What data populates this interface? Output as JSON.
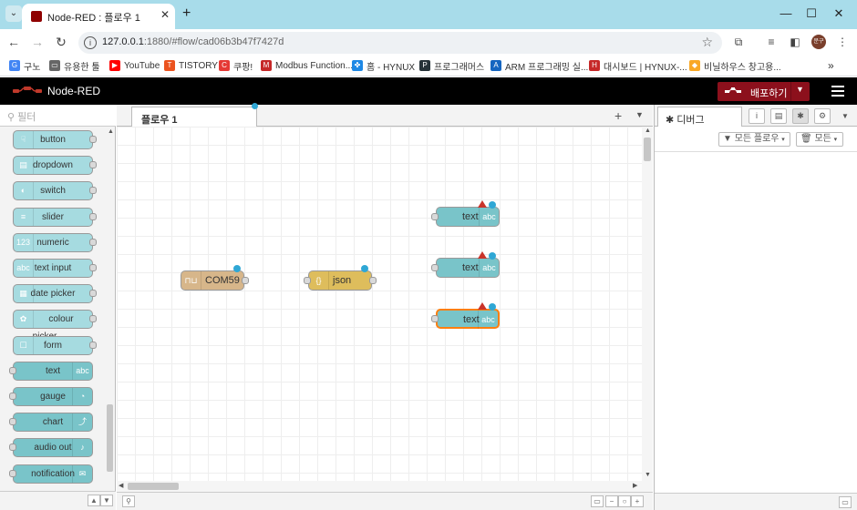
{
  "browser": {
    "tab_title": "Node-RED : 플로우 1",
    "url_host": "127.0.0.1",
    "url_rest": ":1880/#flow/cad06b3b47f7427d",
    "profile_initials": "문구"
  },
  "bookmarks": [
    {
      "label": "구노",
      "color": "#4285f4",
      "glyph": "G"
    },
    {
      "label": "유용한 툴",
      "color": "#666666",
      "glyph": "▭"
    },
    {
      "label": "YouTube",
      "color": "#ff0000",
      "glyph": "▶"
    },
    {
      "label": "TISTORY",
      "color": "#eb531f",
      "glyph": "T"
    },
    {
      "label": "쿠팡!",
      "color": "#e53935",
      "glyph": "C"
    },
    {
      "label": "Modbus Function...",
      "color": "#c62828",
      "glyph": "M"
    },
    {
      "label": "홈 - HYNUX",
      "color": "#1e88e5",
      "glyph": "✤"
    },
    {
      "label": "프로그래머스",
      "color": "#263238",
      "glyph": "P"
    },
    {
      "label": "ARM 프로그래밍 실...",
      "color": "#1565c0",
      "glyph": "A"
    },
    {
      "label": "대시보드 | HYNUX-...",
      "color": "#c62828",
      "glyph": "H"
    },
    {
      "label": "비닐하우스 창고용...",
      "color": "#f9a825",
      "glyph": "◆"
    }
  ],
  "header": {
    "app_title": "Node-RED",
    "deploy_label": "배포하기"
  },
  "palette": {
    "filter_placeholder": "필터",
    "nodes": [
      {
        "label": "button",
        "color": "#a6dbe0",
        "icon_side": "left",
        "icon": "☟"
      },
      {
        "label": "dropdown",
        "color": "#a6dbe0",
        "icon_side": "left",
        "icon": "▤"
      },
      {
        "label": "switch",
        "color": "#a6dbe0",
        "icon_side": "left",
        "icon": "◐"
      },
      {
        "label": "slider",
        "color": "#a6dbe0",
        "icon_side": "left",
        "icon": "≡"
      },
      {
        "label": "numeric",
        "color": "#a6dbe0",
        "icon_side": "left",
        "icon": "123"
      },
      {
        "label": "text input",
        "color": "#a6dbe0",
        "icon_side": "left",
        "icon": "abc"
      },
      {
        "label": "date picker",
        "color": "#a6dbe0",
        "icon_side": "left",
        "icon": "▦"
      },
      {
        "label": "colour picker",
        "color": "#a6dbe0",
        "icon_side": "left",
        "icon": "✿"
      },
      {
        "label": "form",
        "color": "#a6dbe0",
        "icon_side": "left",
        "icon": "☐"
      },
      {
        "label": "text",
        "color": "#79c4c9",
        "icon_side": "right",
        "icon": "abc"
      },
      {
        "label": "gauge",
        "color": "#79c4c9",
        "icon_side": "right",
        "icon": "◔"
      },
      {
        "label": "chart",
        "color": "#79c4c9",
        "icon_side": "right",
        "icon": "⤴"
      },
      {
        "label": "audio out",
        "color": "#79c4c9",
        "icon_side": "right",
        "icon": "♪"
      },
      {
        "label": "notification",
        "color": "#79c4c9",
        "icon_side": "right",
        "icon": "✉"
      }
    ]
  },
  "workspace": {
    "tab_label": "플로우 1",
    "nodes": [
      {
        "label": "COM59",
        "type": "serial-in",
        "color": "#d7b68a",
        "icon": "⊓⊔"
      },
      {
        "label": "json",
        "type": "json",
        "color": "#debd5c",
        "icon": "{}"
      },
      {
        "label": "text",
        "type": "ui-text",
        "color": "#79c4c9",
        "icon": "abc"
      },
      {
        "label": "text",
        "type": "ui-text",
        "color": "#79c4c9",
        "icon": "abc"
      },
      {
        "label": "text",
        "type": "ui-text",
        "color": "#79c4c9",
        "icon": "abc",
        "selected": true
      }
    ]
  },
  "sidebar": {
    "tab_label": "디버그",
    "filter_flows": "모든 플로우",
    "clear_label": "모든"
  },
  "colors": {
    "header": "#000000",
    "deploy": "#8c101c",
    "accent_dot": "#2fa7d5",
    "warn_triangle": "#c9342a"
  }
}
